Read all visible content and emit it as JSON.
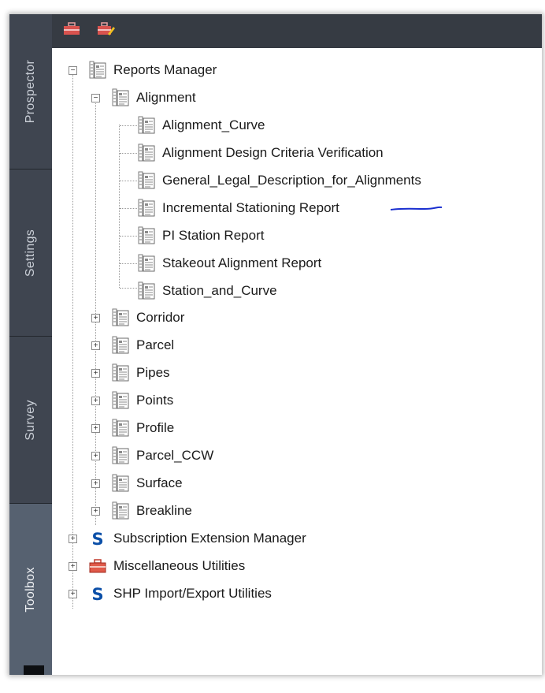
{
  "sidebar_tabs": [
    {
      "label": "Prospector"
    },
    {
      "label": "Settings"
    },
    {
      "label": "Survey"
    },
    {
      "label": "Toolbox"
    }
  ],
  "toolbar": {
    "buttons": [
      {
        "icon": "toolbox-icon"
      },
      {
        "icon": "edit-toolbox-icon"
      }
    ]
  },
  "tree": {
    "root": {
      "label": "Reports Manager",
      "expanded": true
    },
    "alignment": {
      "label": "Alignment",
      "expanded": true,
      "reports": [
        {
          "label": "Alignment_Curve"
        },
        {
          "label": "Alignment Design Criteria Verification"
        },
        {
          "label": "General_Legal_Description_for_Alignments"
        },
        {
          "label": "Incremental Stationing Report"
        },
        {
          "label": "PI Station Report"
        },
        {
          "label": "Stakeout Alignment Report"
        },
        {
          "label": "Station_and_Curve"
        }
      ]
    },
    "categories": [
      {
        "label": "Corridor"
      },
      {
        "label": "Parcel"
      },
      {
        "label": "Pipes"
      },
      {
        "label": "Points"
      },
      {
        "label": "Profile"
      },
      {
        "label": "Parcel_CCW"
      },
      {
        "label": "Surface"
      },
      {
        "label": "Breakline"
      }
    ],
    "top_level_items": [
      {
        "label": "Subscription Extension Manager",
        "icon": "s-logo-icon"
      },
      {
        "label": "Miscellaneous Utilities",
        "icon": "toolbox-icon"
      },
      {
        "label": "SHP Import/Export Utilities",
        "icon": "s-logo-icon"
      }
    ],
    "s_logo_letter": "S"
  },
  "colors": {
    "tab_strip": "#3a3f47",
    "active_tab": "#566170",
    "toolbar": "#363b43",
    "annotation_line": "#1a2fd0",
    "s_logo": "#0b4fa8",
    "toolbox_red": "#c0392b"
  }
}
